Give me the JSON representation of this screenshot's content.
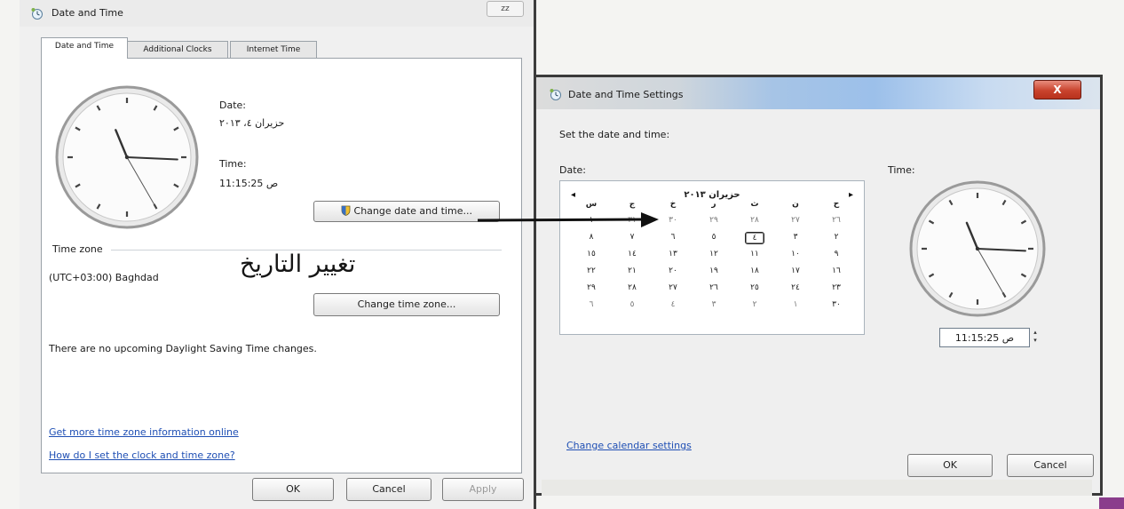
{
  "date_time_window": {
    "title": "Date and Time",
    "title_button": "zz",
    "tabs": [
      "Date and Time",
      "Additional Clocks",
      "Internet Time"
    ],
    "date_label": "Date:",
    "date_value": "حزيران ٤، ٢٠١٣",
    "time_label": "Time:",
    "time_value": "11:15:25 ص",
    "change_date_button": "Change date and time...",
    "timezone_header": "Time zone",
    "timezone_value": "(UTC+03:00) Baghdad",
    "change_timezone_button": "Change time zone...",
    "dst_message": "There are no upcoming Daylight Saving Time changes.",
    "link_timezone_info": "Get more time zone information online",
    "link_how_set": "How do I set the clock and time zone?",
    "ok": "OK",
    "cancel": "Cancel",
    "apply": "Apply",
    "overlay_caption": "تغيير التاريخ"
  },
  "settings_window": {
    "title": "Date and Time Settings",
    "close": "X",
    "instruction": "Set the date and time:",
    "date_label": "Date:",
    "time_label": "Time:",
    "calendar": {
      "month_title": "حزيران ٢٠١٣",
      "prev": "◂",
      "next": "▸",
      "weekdays": [
        "ح",
        "ن",
        "ث",
        "ر",
        "خ",
        "ج",
        "س"
      ],
      "weeks": [
        [
          "٢٦",
          "٢٧",
          "٢٨",
          "٢٩",
          "٣٠",
          "٣١",
          "١"
        ],
        [
          "٢",
          "٣",
          "٤",
          "٥",
          "٦",
          "٧",
          "٨"
        ],
        [
          "٩",
          "١٠",
          "١١",
          "١٢",
          "١٣",
          "١٤",
          "١٥"
        ],
        [
          "١٦",
          "١٧",
          "١٨",
          "١٩",
          "٢٠",
          "٢١",
          "٢٢"
        ],
        [
          "٢٣",
          "٢٤",
          "٢٥",
          "٢٦",
          "٢٧",
          "٢٨",
          "٢٩"
        ],
        [
          "٣٠",
          "١",
          "٢",
          "٣",
          "٤",
          "٥",
          "٦"
        ]
      ],
      "selected_day": "٤"
    },
    "time_value": "11:15:25 ص",
    "change_calendar_link": "Change calendar settings",
    "ok": "OK",
    "cancel": "Cancel"
  },
  "clock": {
    "hours": 11,
    "minutes": 15,
    "seconds": 25
  },
  "colors": {
    "link": "#1f4fb4",
    "close": "#c9432d",
    "title_blue": "#9cc0ea"
  }
}
